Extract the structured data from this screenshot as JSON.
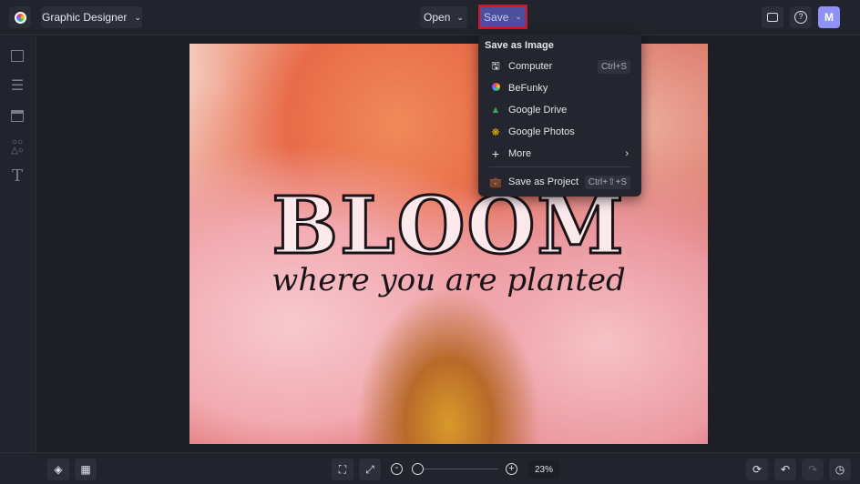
{
  "header": {
    "app_title": "Graphic Designer",
    "open_label": "Open",
    "save_label": "Save",
    "avatar_initial": "M"
  },
  "save_menu": {
    "heading": "Save as Image",
    "items": [
      {
        "label": "Computer",
        "shortcut": "Ctrl+S"
      },
      {
        "label": "BeFunky"
      },
      {
        "label": "Google Drive"
      },
      {
        "label": "Google Photos"
      },
      {
        "label": "More"
      },
      {
        "label": "Save as Project",
        "shortcut": "Ctrl+⇧+S"
      }
    ]
  },
  "canvas": {
    "title_text": "BLOOM",
    "subtitle_text": "where you are planted"
  },
  "footer": {
    "zoom_value": "23%",
    "zoom_slider_fraction": 0.05
  },
  "colors": {
    "accent": "#4c4f9c",
    "highlight": "#e0101b",
    "avatar": "#8f93f5"
  }
}
